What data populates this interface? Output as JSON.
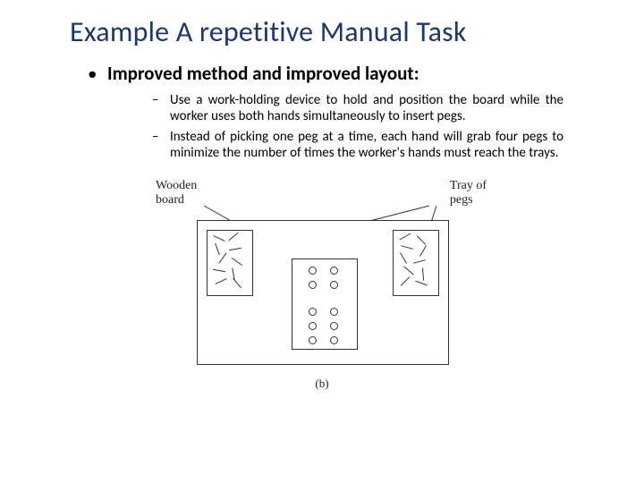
{
  "title": "Example A repetitive Manual Task",
  "heading1": "Improved method and improved layout:",
  "sub": [
    "Use a work-holding device to hold and position the board while the worker uses both hands simultaneously to insert pegs.",
    "Instead of picking one peg at a time, each hand will grab four pegs to minimize the number of times the worker's hands must reach the trays."
  ],
  "figure": {
    "label_left": "Wooden\nboard",
    "label_right": "Tray of\npegs",
    "caption": "(b)"
  }
}
